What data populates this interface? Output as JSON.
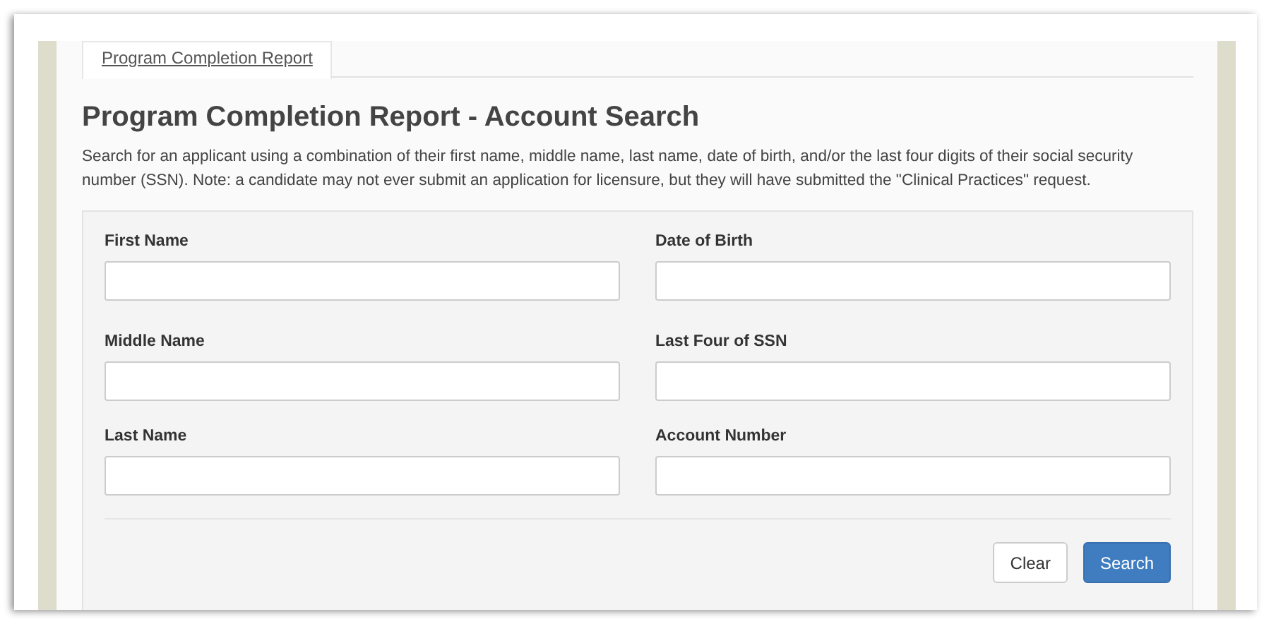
{
  "tabs": [
    {
      "label": "Program Completion Report",
      "selected": true
    }
  ],
  "heading": "Program Completion Report - Account Search",
  "description": "Search for an applicant using a combination of their first name, middle name, last name, date of birth, and/or the last four digits of their social security number (SSN). Note: a candidate may not ever submit an application for licensure, but they will have submitted the \"Clinical Practices\" request.",
  "fields": [
    {
      "label": "First Name"
    },
    {
      "label": "Date of Birth"
    },
    {
      "label": "Middle Name"
    },
    {
      "label": "Last Four of SSN"
    },
    {
      "label": "Last Name"
    },
    {
      "label": "Account Number"
    }
  ],
  "buttons": [
    {
      "label": "Clear",
      "kind": "default"
    },
    {
      "label": "Search",
      "kind": "primary"
    }
  ]
}
